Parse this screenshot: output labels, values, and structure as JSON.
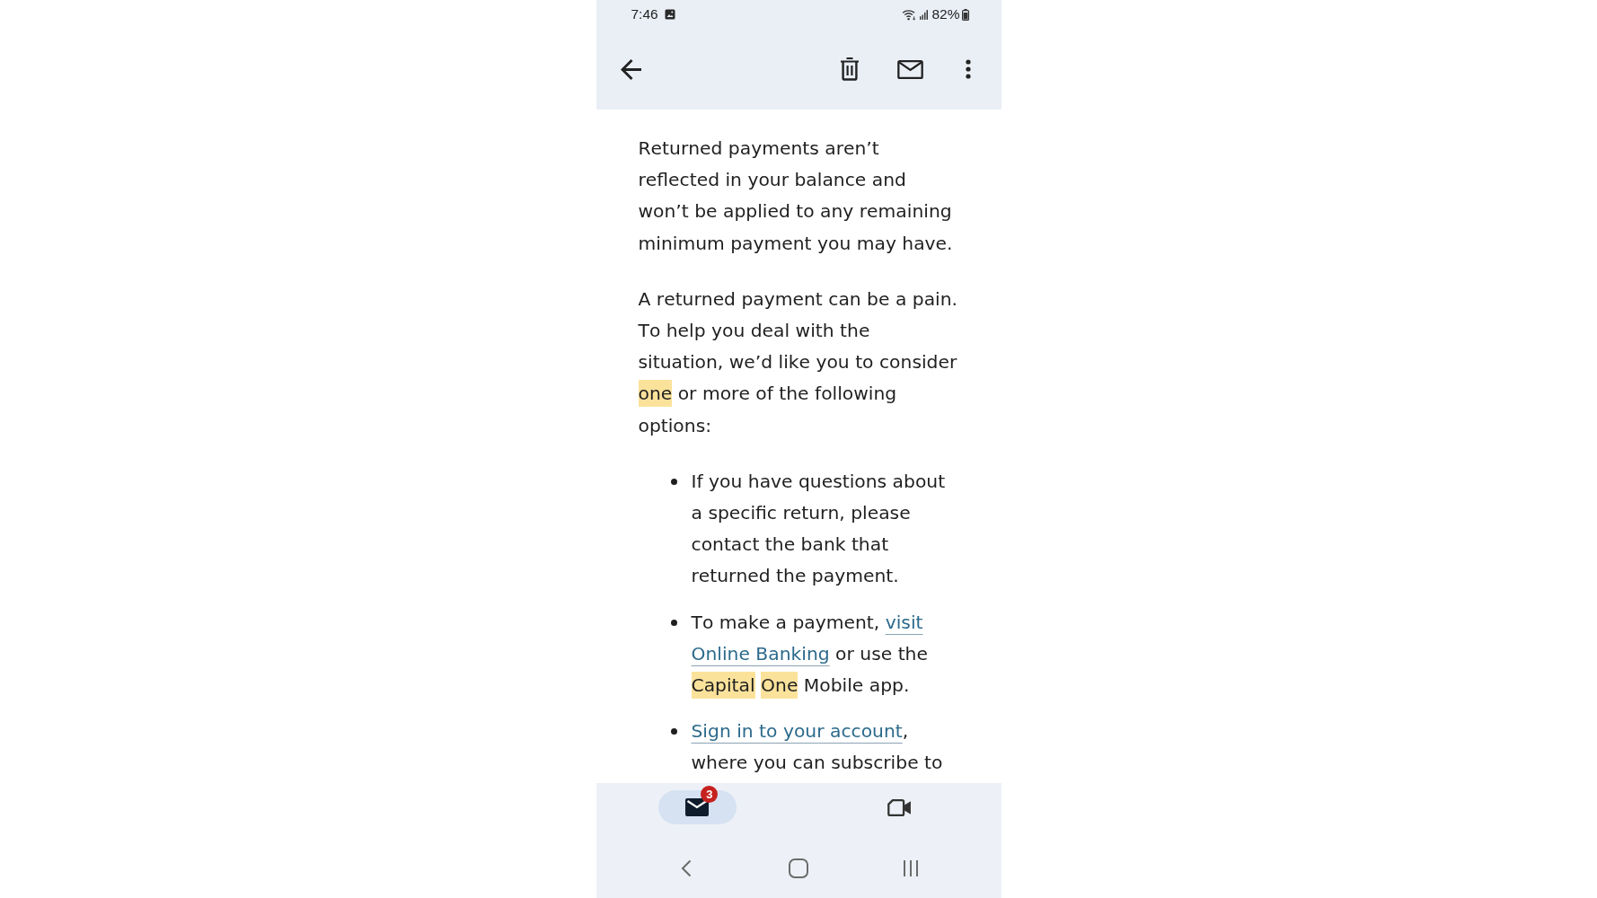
{
  "status_bar": {
    "time": "7:46",
    "battery": "82%"
  },
  "body": {
    "paragraphs": [
      {
        "runs": [
          {
            "kind": "text",
            "text": "Returned payments aren’t reflected in your balance and won’t be applied to any remaining minimum payment you may have."
          }
        ]
      },
      {
        "runs": [
          {
            "kind": "text",
            "text": "A returned payment can be a pain. To help you deal with the situation, we’d like you to consider "
          },
          {
            "kind": "highlight",
            "text": "one"
          },
          {
            "kind": "text",
            "text": " or more of the following options:"
          }
        ]
      }
    ],
    "options": [
      {
        "runs": [
          {
            "kind": "text",
            "text": "If you have questions about a specific return, please contact the bank that returned the payment."
          }
        ]
      },
      {
        "runs": [
          {
            "kind": "text",
            "text": "To make a payment, "
          },
          {
            "kind": "link",
            "text": "visit "
          },
          {
            "kind": "link",
            "text": "Online Banking"
          },
          {
            "kind": "text",
            "text": " or use the "
          },
          {
            "kind": "highlight",
            "text": "Capital "
          },
          {
            "kind": "highlight",
            "text": "One"
          },
          {
            "kind": "text",
            "text": " Mobile app."
          }
        ]
      },
      {
        "runs": [
          {
            "kind": "link",
            "text": "Sign in to your account"
          },
          {
            "kind": "text",
            "text": ", where you can subscribe to"
          }
        ]
      }
    ]
  },
  "bottom_nav": {
    "tabs": [
      {
        "kind": "mail",
        "selected": true,
        "badge": "3"
      },
      {
        "kind": "video",
        "selected": false
      }
    ]
  }
}
